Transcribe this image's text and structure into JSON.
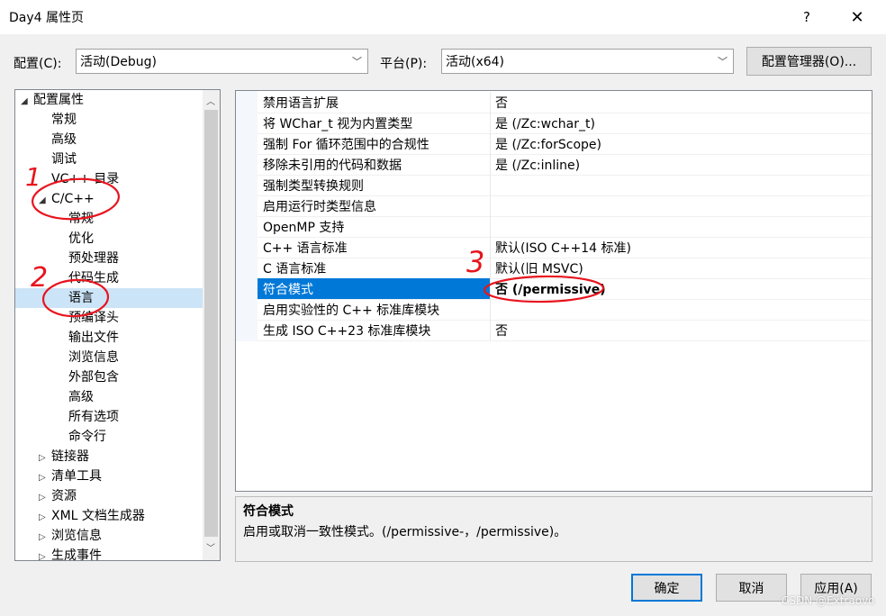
{
  "window": {
    "title": "Day4 属性页",
    "help": "?",
    "close": "✕"
  },
  "toolbar": {
    "config_label": "配置(C):",
    "config_value": "活动(Debug)",
    "platform_label": "平台(P):",
    "platform_value": "活动(x64)",
    "config_manager": "配置管理器(O)..."
  },
  "tree": {
    "items": [
      {
        "label": "配置属性",
        "twisty": "◢",
        "level": 0
      },
      {
        "label": "常规",
        "twisty": "",
        "level": 1
      },
      {
        "label": "高级",
        "twisty": "",
        "level": 1
      },
      {
        "label": "调试",
        "twisty": "",
        "level": 1
      },
      {
        "label": "VC++ 目录",
        "twisty": "",
        "level": 1
      },
      {
        "label": "C/C++",
        "twisty": "◢",
        "level": 1
      },
      {
        "label": "常规",
        "twisty": "",
        "level": 2
      },
      {
        "label": "优化",
        "twisty": "",
        "level": 2
      },
      {
        "label": "预处理器",
        "twisty": "",
        "level": 2
      },
      {
        "label": "代码生成",
        "twisty": "",
        "level": 2
      },
      {
        "label": "语言",
        "twisty": "",
        "level": 2,
        "selected": true
      },
      {
        "label": "预编译头",
        "twisty": "",
        "level": 2
      },
      {
        "label": "输出文件",
        "twisty": "",
        "level": 2
      },
      {
        "label": "浏览信息",
        "twisty": "",
        "level": 2
      },
      {
        "label": "外部包含",
        "twisty": "",
        "level": 2
      },
      {
        "label": "高级",
        "twisty": "",
        "level": 2
      },
      {
        "label": "所有选项",
        "twisty": "",
        "level": 2
      },
      {
        "label": "命令行",
        "twisty": "",
        "level": 2
      },
      {
        "label": "链接器",
        "twisty": "▷",
        "level": 1
      },
      {
        "label": "清单工具",
        "twisty": "▷",
        "level": 1
      },
      {
        "label": "资源",
        "twisty": "▷",
        "level": 1
      },
      {
        "label": "XML 文档生成器",
        "twisty": "▷",
        "level": 1
      },
      {
        "label": "浏览信息",
        "twisty": "▷",
        "level": 1
      },
      {
        "label": "生成事件",
        "twisty": "▷",
        "level": 1
      }
    ]
  },
  "grid": {
    "rows": [
      {
        "name": "禁用语言扩展",
        "value": "否"
      },
      {
        "name": "将 WChar_t 视为内置类型",
        "value": "是 (/Zc:wchar_t)"
      },
      {
        "name": "强制 For 循环范围中的合规性",
        "value": "是 (/Zc:forScope)"
      },
      {
        "name": "移除未引用的代码和数据",
        "value": "是 (/Zc:inline)"
      },
      {
        "name": "强制类型转换规则",
        "value": ""
      },
      {
        "name": "启用运行时类型信息",
        "value": ""
      },
      {
        "name": "OpenMP 支持",
        "value": ""
      },
      {
        "name": "C++ 语言标准",
        "value": "默认(ISO C++14 标准)"
      },
      {
        "name": "C 语言标准",
        "value": "默认(旧 MSVC)"
      },
      {
        "name": "符合模式",
        "value": "否 (/permissive)",
        "selected": true
      },
      {
        "name": "启用实验性的 C++ 标准库模块",
        "value": ""
      },
      {
        "name": "生成 ISO C++23 标准库模块",
        "value": "否"
      }
    ]
  },
  "description": {
    "title": "符合模式",
    "text": "启用或取消一致性模式。(/permissive-，/permissive)。"
  },
  "footer": {
    "ok": "确定",
    "cancel": "取消",
    "apply": "应用(A)"
  },
  "watermark": "CSDN @Extraovo",
  "annotations": {
    "n1": "1",
    "n2": "2",
    "n3": "3",
    "color": "#e8141e"
  },
  "colors": {
    "accent": "#0078d7",
    "selection_tree": "#cce4f7"
  }
}
